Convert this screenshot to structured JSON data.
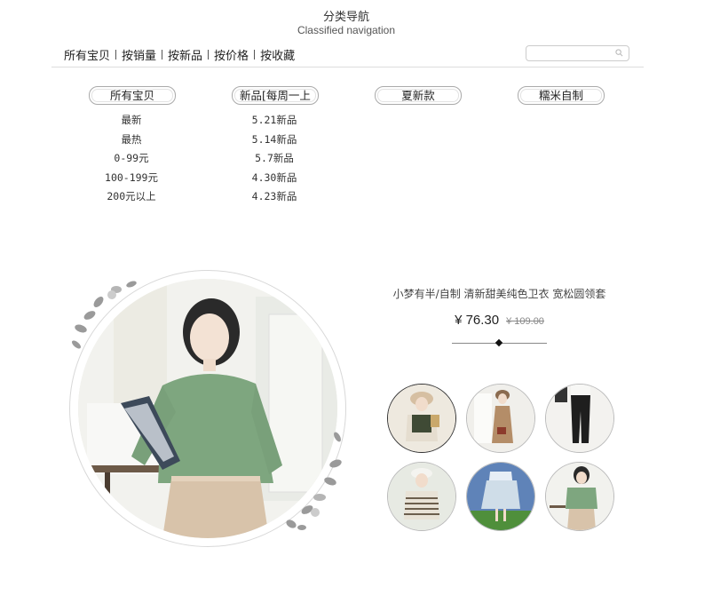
{
  "header": {
    "title": "分类导航",
    "subtitle": "Classified navigation"
  },
  "nav": [
    {
      "label": "所有宝贝"
    },
    {
      "label": "按销量"
    },
    {
      "label": "按新品"
    },
    {
      "label": "按价格"
    },
    {
      "label": "按收藏"
    }
  ],
  "search": {
    "placeholder": "",
    "icon": "search-icon"
  },
  "categories": {
    "all": {
      "title": "所有宝贝",
      "items": [
        "最新",
        "最热",
        "0-99元",
        "100-199元",
        "200元以上"
      ]
    },
    "new": {
      "title": "新品[每周一上",
      "items": [
        "5.21新品",
        "5.14新品",
        "5.7新品",
        "4.30新品",
        "4.23新品"
      ]
    },
    "summer": {
      "title": "夏新款"
    },
    "custom": {
      "title": "糯米自制"
    }
  },
  "product": {
    "title": "小梦有半/自制 清新甜美纯色卫衣 宽松圆领套",
    "price": "¥ 76.30",
    "old_price": "¥ 109.00"
  },
  "colors": {
    "accent": "#333333",
    "sweater": "#7ea67f",
    "skirt": "#d8c3aa"
  }
}
